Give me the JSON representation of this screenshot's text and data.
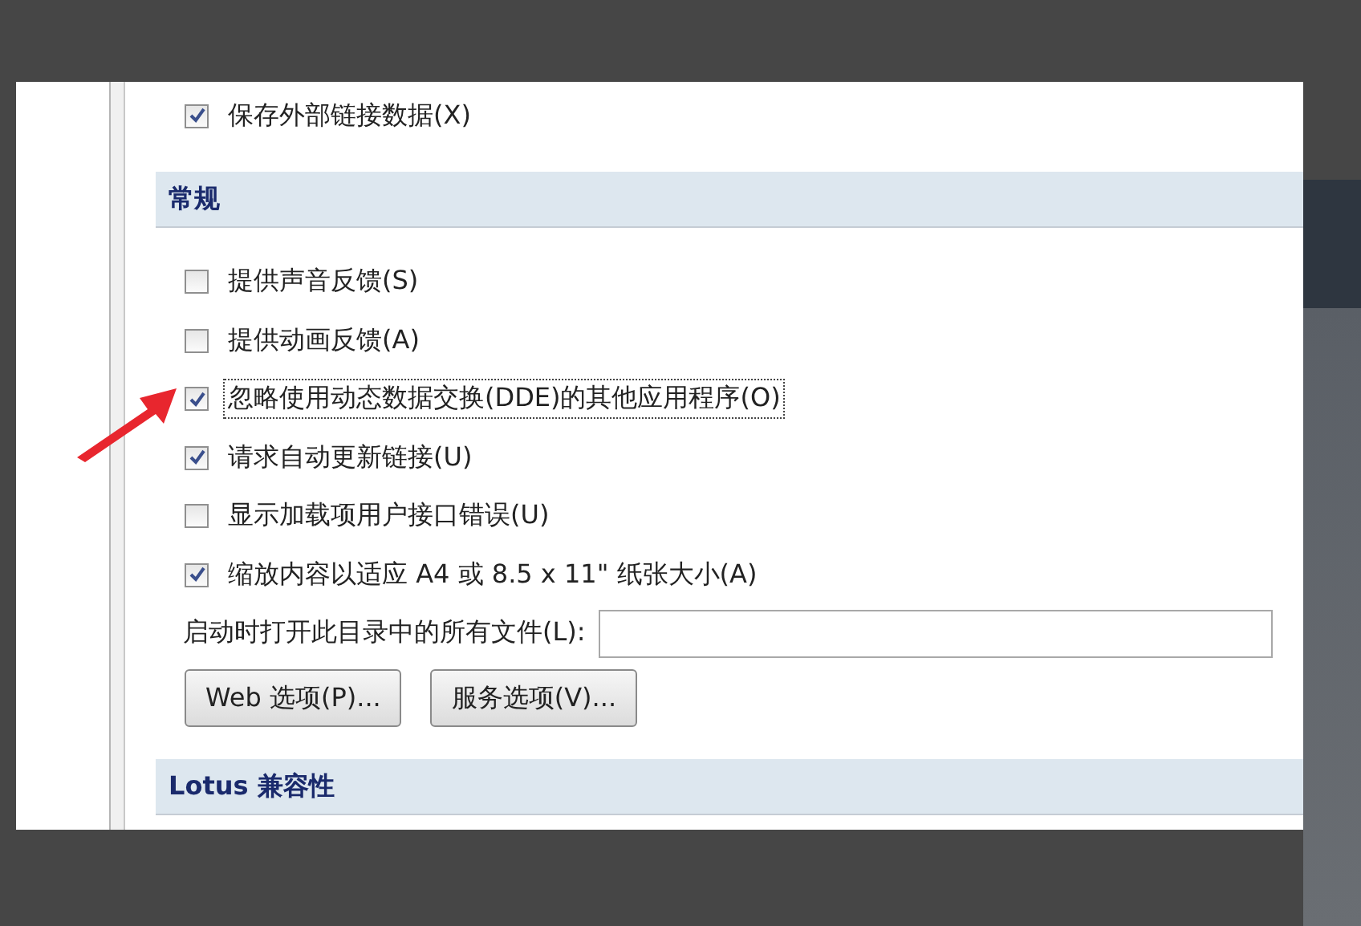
{
  "sections": [
    {
      "kind": "options",
      "items": [
        {
          "kind": "checkbox",
          "label": "保存外部链接数据(X)",
          "checked": true,
          "focused": false
        }
      ]
    },
    {
      "kind": "group",
      "title": "常规",
      "items": [
        {
          "kind": "checkbox",
          "label": "提供声音反馈(S)",
          "checked": false,
          "focused": false
        },
        {
          "kind": "checkbox",
          "label": "提供动画反馈(A)",
          "checked": false,
          "focused": false
        },
        {
          "kind": "checkbox",
          "label": "忽略使用动态数据交换(DDE)的其他应用程序(O)",
          "checked": true,
          "focused": true
        },
        {
          "kind": "checkbox",
          "label": "请求自动更新链接(U)",
          "checked": true,
          "focused": false
        },
        {
          "kind": "checkbox",
          "label": "显示加载项用户接口错误(U)",
          "checked": false,
          "focused": false
        },
        {
          "kind": "checkbox",
          "label": "缩放内容以适应 A4 或 8.5 x 11\" 纸张大小(A)",
          "checked": true,
          "focused": false
        },
        {
          "kind": "field",
          "label": "启动时打开此目录中的所有文件(L):"
        },
        {
          "kind": "buttons",
          "buttons": [
            "Web 选项(P)...",
            "服务选项(V)..."
          ]
        }
      ]
    },
    {
      "kind": "group",
      "title": "Lotus 兼容性"
    }
  ]
}
